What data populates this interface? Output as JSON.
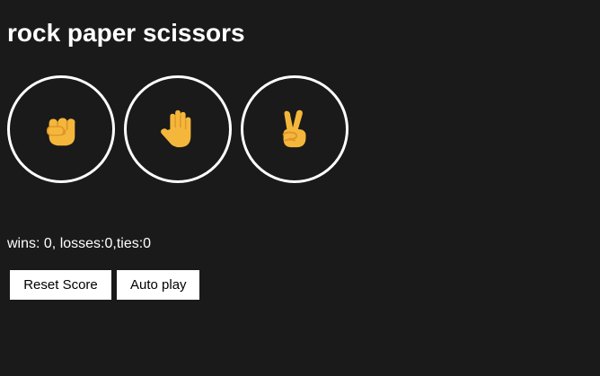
{
  "page": {
    "title": "rock paper scissors"
  },
  "moves": [
    {
      "name": "rock",
      "icon": "fist-icon"
    },
    {
      "name": "paper",
      "icon": "raised-hand-icon"
    },
    {
      "name": "scissors",
      "icon": "victory-hand-icon"
    }
  ],
  "score": {
    "text": "wins: 0, losses:0,ties:0",
    "wins": 0,
    "losses": 0,
    "ties": 0
  },
  "controls": {
    "reset_label": "Reset Score",
    "autoplay_label": "Auto play"
  },
  "colors": {
    "background": "#1a1a1a",
    "text": "#ffffff",
    "circle_border": "#ffffff",
    "emoji_fill": "#f4b73b",
    "emoji_shade": "#e0962a",
    "button_background": "#ffffff",
    "button_text": "#000000"
  }
}
